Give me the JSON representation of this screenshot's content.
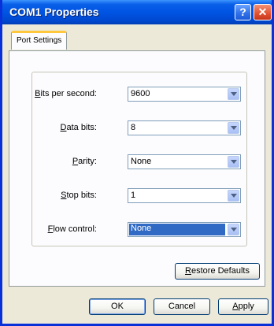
{
  "window": {
    "title": "COM1 Properties",
    "help_glyph": "?",
    "close_glyph": "✕"
  },
  "tabs": [
    {
      "label": "Port Settings",
      "active": true
    }
  ],
  "fields": [
    {
      "mnemonic": "B",
      "label_rest": "its per second:",
      "value": "9600"
    },
    {
      "mnemonic": "D",
      "label_rest": "ata bits:",
      "value": "8"
    },
    {
      "mnemonic": "P",
      "label_rest": "arity:",
      "value": "None"
    },
    {
      "mnemonic": "S",
      "label_rest": "top bits:",
      "value": "1"
    },
    {
      "mnemonic": "F",
      "label_rest": "low control:",
      "value": "None"
    }
  ],
  "buttons": {
    "restore": {
      "mnemonic": "R",
      "rest": "estore Defaults"
    },
    "ok": "OK",
    "cancel": "Cancel",
    "apply": {
      "mnemonic": "A",
      "rest": "pply"
    }
  },
  "colors": {
    "title_bar": "#0054e3",
    "window_border": "#0831d9",
    "dialog_face": "#ece9d8",
    "selection": "#316ac5",
    "close_button": "#e05030"
  }
}
